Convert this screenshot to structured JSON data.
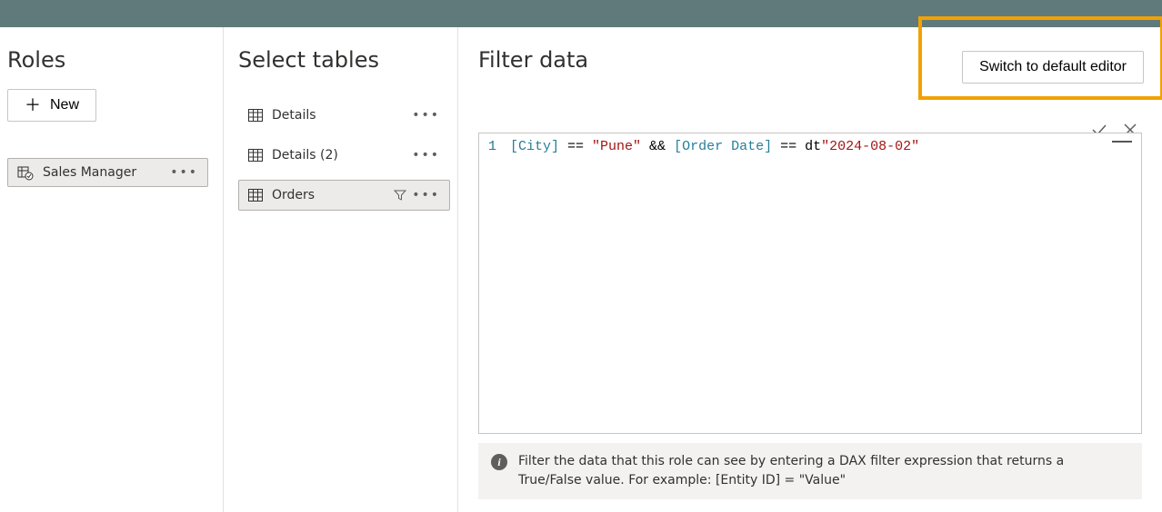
{
  "roles": {
    "heading": "Roles",
    "new_label": "New",
    "items": [
      {
        "name": "Sales Manager",
        "selected": true
      }
    ]
  },
  "tables": {
    "heading": "Select tables",
    "items": [
      {
        "name": "Details",
        "selected": false,
        "has_filter": false
      },
      {
        "name": "Details (2)",
        "selected": false,
        "has_filter": false
      },
      {
        "name": "Orders",
        "selected": true,
        "has_filter": true
      }
    ]
  },
  "filter": {
    "heading": "Filter data",
    "switch_label": "Switch to default editor",
    "code": {
      "line_no": "1",
      "tokens": {
        "field1": "[City]",
        "op1": " == ",
        "str1": "\"Pune\"",
        "op2": " && ",
        "field2": "[Order Date]",
        "op3": " == ",
        "kw": "dt",
        "str2": "\"2024-08-02\""
      }
    },
    "info": "Filter the data that this role can see by entering a DAX filter expression that returns a True/False value. For example: [Entity ID] = \"Value\""
  }
}
